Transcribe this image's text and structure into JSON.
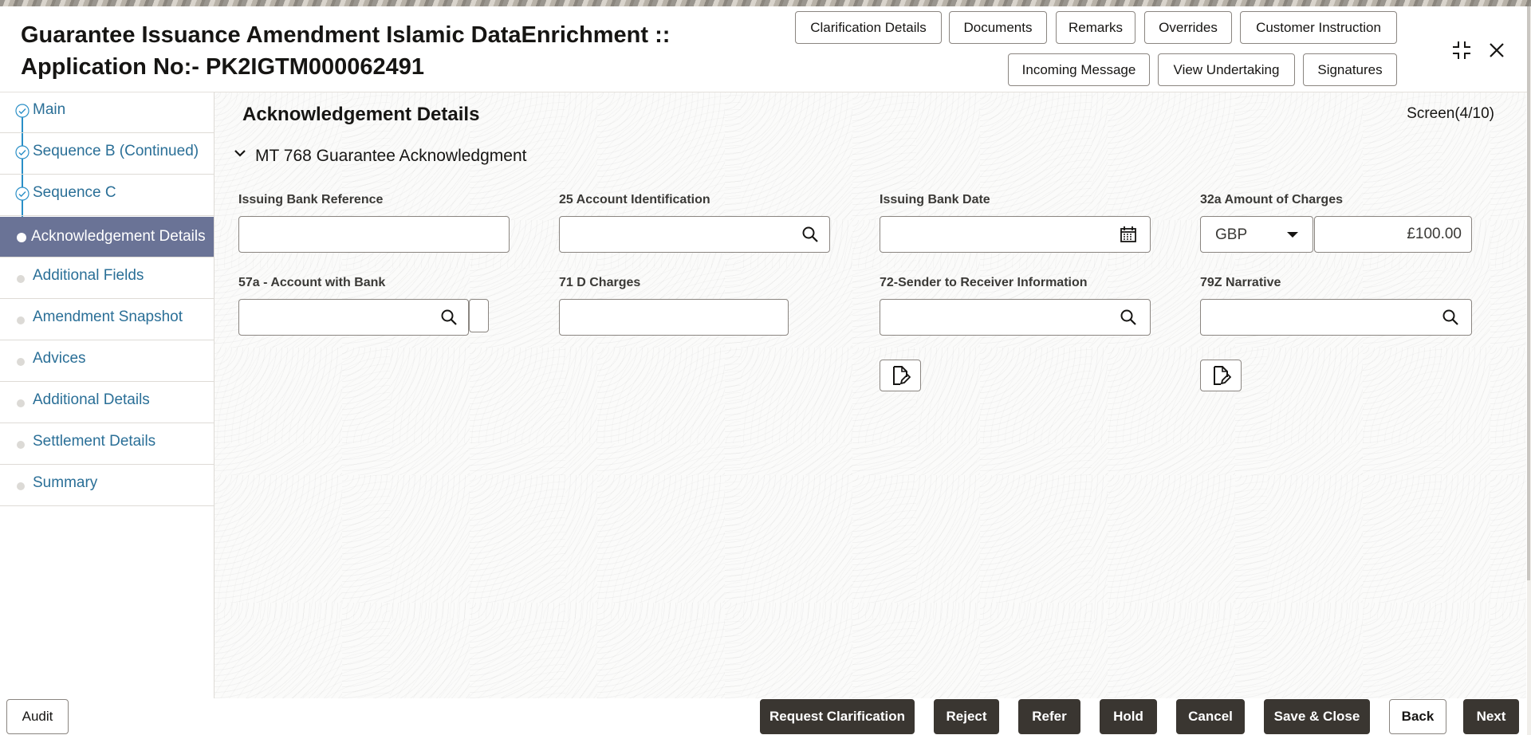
{
  "window": {
    "title_line1": "Guarantee Issuance Amendment Islamic DataEnrichment ::",
    "title_line2": "Application No:- PK2IGTM000062491"
  },
  "header_buttons": {
    "clarification_details": "Clarification Details",
    "documents": "Documents",
    "remarks": "Remarks",
    "overrides": "Overrides",
    "customer_instruction": "Customer Instruction",
    "incoming_message": "Incoming Message",
    "view_undertaking": "View Undertaking",
    "signatures": "Signatures"
  },
  "sidebar": {
    "items": [
      {
        "label": "Main",
        "state": "completed"
      },
      {
        "label": "Sequence B (Continued)",
        "state": "completed"
      },
      {
        "label": "Sequence C",
        "state": "completed"
      },
      {
        "label": "Acknowledgement Details",
        "state": "active"
      },
      {
        "label": "Additional Fields",
        "state": "pending"
      },
      {
        "label": "Amendment Snapshot",
        "state": "pending"
      },
      {
        "label": "Advices",
        "state": "pending"
      },
      {
        "label": "Additional Details",
        "state": "pending"
      },
      {
        "label": "Settlement Details",
        "state": "pending"
      },
      {
        "label": "Summary",
        "state": "pending"
      }
    ]
  },
  "main": {
    "screen_title": "Acknowledgement Details",
    "screen_count": "Screen(4/10)",
    "section_title": "MT 768 Guarantee Acknowledgment",
    "fields": {
      "issuing_bank_reference": {
        "label": "Issuing Bank Reference",
        "value": ""
      },
      "account_identification": {
        "label": "25 Account Identification",
        "value": ""
      },
      "issuing_bank_date": {
        "label": "Issuing Bank Date",
        "value": ""
      },
      "amount_of_charges": {
        "label": "32a Amount of Charges",
        "currency": "GBP",
        "amount": "£100.00"
      },
      "account_with_bank": {
        "label": "57a - Account with Bank",
        "value": ""
      },
      "d_charges": {
        "label": "71 D Charges",
        "value": ""
      },
      "sender_to_receiver": {
        "label": "72-Sender to Receiver Information",
        "value": ""
      },
      "narrative": {
        "label": "79Z Narrative",
        "value": ""
      }
    }
  },
  "footer_buttons": {
    "audit": "Audit",
    "request_clarification": "Request Clarification",
    "reject": "Reject",
    "refer": "Refer",
    "hold": "Hold",
    "cancel": "Cancel",
    "save_close": "Save & Close",
    "back": "Back",
    "next": "Next"
  },
  "colors": {
    "active_nav_bg": "#6a7396",
    "nav_link": "#2a6f97",
    "primary_button_bg": "#3a3631"
  }
}
